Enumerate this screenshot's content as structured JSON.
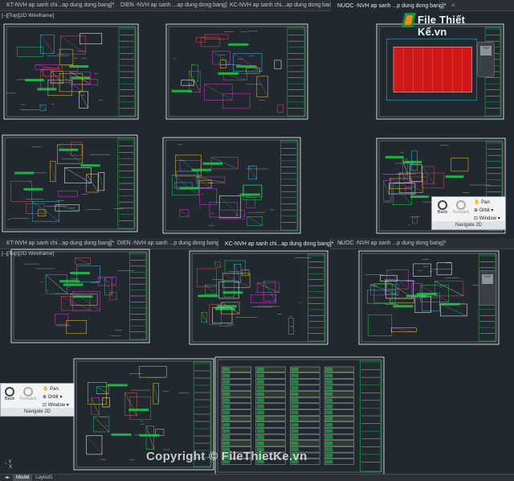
{
  "window1": {
    "tabs": [
      {
        "label": "KT-NVH ap sanh chi...ap dung dong bang]*",
        "active": false
      },
      {
        "label": "DIEN -NVH ap sanh ...ap dung dong bang]",
        "active": false
      },
      {
        "label": "KC-NVH ap sanh chi...ap dung dong bang]",
        "active": false
      },
      {
        "label": "NUOC -NVH ap sanh ...p dung dong bang]*",
        "active": true
      }
    ],
    "viewport_label": "[–][Top][2D Wireframe]"
  },
  "window2": {
    "tabs": [
      {
        "label": "KT-NVH ap sanh chi...ap dung dong bang]*",
        "active": false
      },
      {
        "label": "DIEN -NVH ap sanh ...p dung dong bang]",
        "active": false
      },
      {
        "label": "KC-NVH ap sanh chi...ap dung dong bang]*",
        "active": true
      },
      {
        "label": "NUOC -NVH ap sanh ...p dung dong bang]*",
        "active": false
      }
    ],
    "viewport_label": "[–][Top][2D Wireframe]",
    "layout_tabs": [
      "Model",
      "Layout1"
    ]
  },
  "navigate2d": {
    "back": "Back",
    "forward": "Forward",
    "pan": "Pan",
    "orbit": "Orbit",
    "window": "Window",
    "caption": "Navigate 2D"
  },
  "logo": {
    "text": "File Thiết Kế.vn"
  },
  "watermark": {
    "text": "Copyright © FileThietKe.vn"
  },
  "icons": [
    "close-icon",
    "back-icon",
    "forward-icon",
    "pan-icon",
    "orbit-icon",
    "window-zoom-icon",
    "ucs-icon",
    "viewcube-icon"
  ],
  "colors": {
    "canvas": "#212830",
    "sheet_border": "#ffffff",
    "title_block_green": "#1fd14a",
    "red_fill": "#d11818",
    "accent_yellow": "#f0d020",
    "accent_cyan": "#22c9e8",
    "accent_magenta": "#d838d8"
  }
}
